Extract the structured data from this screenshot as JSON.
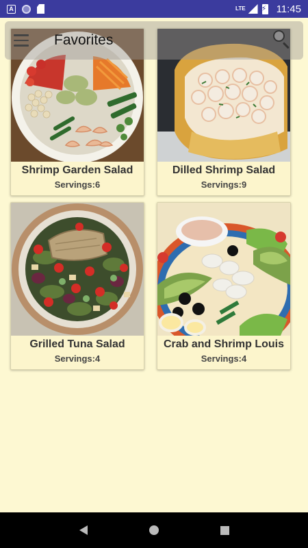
{
  "status_bar": {
    "time": "11:45",
    "network": "LTE",
    "icons": [
      "notification-a-icon",
      "sync-circle-icon",
      "sd-card-icon",
      "signal-icon",
      "battery-charging-icon"
    ]
  },
  "toolbar": {
    "title": "Favorites",
    "menu_icon": "hamburger-menu-icon",
    "search_icon": "search-icon"
  },
  "recipes": [
    {
      "title": "Shrimp Garden Salad",
      "servings": "Servings:6"
    },
    {
      "title": "Dilled Shrimp Salad",
      "servings": "Servings:9"
    },
    {
      "title": "Grilled Tuna Salad",
      "servings": "Servings:4"
    },
    {
      "title": "Crab and Shrimp Louis",
      "servings": "Servings:4"
    }
  ],
  "colors": {
    "status_bar": "#3b3b9e",
    "background": "#fdf8d2",
    "card": "#fcf5cc"
  }
}
